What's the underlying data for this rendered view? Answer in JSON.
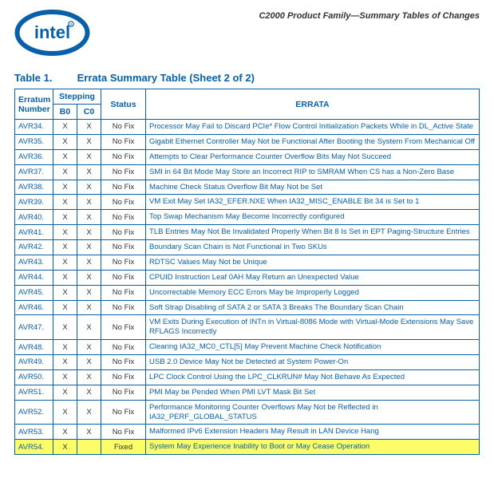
{
  "header": {
    "doc_title": "C2000 Product Family—Summary Tables of Changes",
    "logo_text": "intel"
  },
  "table": {
    "label_prefix": "Table 1.",
    "label_title": "Errata Summary Table (Sheet 2 of 2)",
    "columns": {
      "erratum_number": "Erratum Number",
      "stepping": "Stepping",
      "step_b0": "B0",
      "step_c0": "C0",
      "status": "Status",
      "errata": "ERRATA"
    },
    "rows": [
      {
        "num": "AVR34.",
        "b0": "X",
        "c0": "X",
        "status": "No Fix",
        "desc": "Processor May Fail to Discard PCIe* Flow Control Initialization Packets While in DL_Active State",
        "hl": false
      },
      {
        "num": "AVR35.",
        "b0": "X",
        "c0": "X",
        "status": "No Fix",
        "desc": "Gigabit Ethernet Controller May Not be Functional After Booting the System From Mechanical Off",
        "hl": false
      },
      {
        "num": "AVR36.",
        "b0": "X",
        "c0": "X",
        "status": "No Fix",
        "desc": "Attempts to Clear Performance Counter Overflow Bits May Not Succeed",
        "hl": false
      },
      {
        "num": "AVR37.",
        "b0": "X",
        "c0": "X",
        "status": "No Fix",
        "desc": "SMI in 64 Bit Mode May Store an Incorrect RIP to SMRAM When CS has a Non-Zero Base",
        "hl": false
      },
      {
        "num": "AVR38.",
        "b0": "X",
        "c0": "X",
        "status": "No Fix",
        "desc": "Machine Check Status Overflow Bit May Not be Set",
        "hl": false
      },
      {
        "num": "AVR39.",
        "b0": "X",
        "c0": "X",
        "status": "No Fix",
        "desc": "VM Exit May Set IA32_EFER.NXE When IA32_MISC_ENABLE Bit 34 is Set to 1",
        "hl": false
      },
      {
        "num": "AVR40.",
        "b0": "X",
        "c0": "X",
        "status": "No Fix",
        "desc": "Top Swap Mechanism May Become Incorrectly configured",
        "hl": false
      },
      {
        "num": "AVR41.",
        "b0": "X",
        "c0": "X",
        "status": "No Fix",
        "desc": "TLB Entries May Not Be Invalidated Properly When Bit 8 Is Set in EPT Paging-Structure Entries",
        "hl": false
      },
      {
        "num": "AVR42.",
        "b0": "X",
        "c0": "X",
        "status": "No Fix",
        "desc": "Boundary Scan Chain is Not Functional in Two SKUs",
        "hl": false
      },
      {
        "num": "AVR43.",
        "b0": "X",
        "c0": "X",
        "status": "No Fix",
        "desc": "RDTSC Values May Not be Unique",
        "hl": false
      },
      {
        "num": "AVR44.",
        "b0": "X",
        "c0": "X",
        "status": "No Fix",
        "desc": "CPUID Instruction Leaf 0AH May Return an Unexpected Value",
        "hl": false
      },
      {
        "num": "AVR45.",
        "b0": "X",
        "c0": "X",
        "status": "No Fix",
        "desc": "Uncorrectable Memory ECC Errors May be Improperly Logged",
        "hl": false
      },
      {
        "num": "AVR46.",
        "b0": "X",
        "c0": "X",
        "status": "No Fix",
        "desc": "Soft Strap Disabling of SATA 2 or SATA 3 Breaks The Boundary Scan Chain",
        "hl": false
      },
      {
        "num": "AVR47.",
        "b0": "X",
        "c0": "X",
        "status": "No Fix",
        "desc": "VM Exits During Execution of INTn in Virtual-8086 Mode with Virtual-Mode Extensions May Save RFLAGS Incorrectly",
        "hl": false
      },
      {
        "num": "AVR48.",
        "b0": "X",
        "c0": "X",
        "status": "No Fix",
        "desc": "Clearing IA32_MC0_CTL[5] May Prevent Machine Check Notification",
        "hl": false
      },
      {
        "num": "AVR49.",
        "b0": "X",
        "c0": "X",
        "status": "No Fix",
        "desc": "USB 2.0 Device May Not be Detected at System Power-On",
        "hl": false
      },
      {
        "num": "AVR50.",
        "b0": "X",
        "c0": "X",
        "status": "No Fix",
        "desc": "LPC Clock Control Using the LPC_CLKRUN# May Not Behave As Expected",
        "hl": false
      },
      {
        "num": "AVR51.",
        "b0": "X",
        "c0": "X",
        "status": "No Fix",
        "desc": "PMI May be Pended When PMI LVT Mask Bit Set",
        "hl": false
      },
      {
        "num": "AVR52.",
        "b0": "X",
        "c0": "X",
        "status": "No Fix",
        "desc": "Performance Monitoring Counter Overflows May Not be Reflected in IA32_PERF_GLOBAL_STATUS",
        "hl": false
      },
      {
        "num": "AVR53.",
        "b0": "X",
        "c0": "X",
        "status": "No Fix",
        "desc": "Malformed IPv6 Extension Headers May Result in LAN Device Hang",
        "hl": false
      },
      {
        "num": "AVR54.",
        "b0": "X",
        "c0": "",
        "status": "Fixed",
        "desc": "System May Experience Inability to Boot or May Cease Operation",
        "hl": true
      }
    ]
  }
}
